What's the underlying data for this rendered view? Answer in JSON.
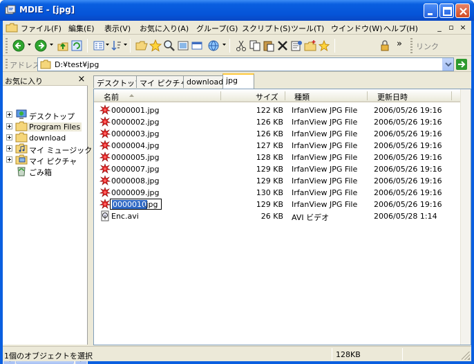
{
  "window": {
    "title": "MDIE - [jpg]",
    "buttons": [
      "minimize",
      "maximize",
      "close"
    ]
  },
  "menubar": {
    "items": [
      {
        "label": "ファイル(F)"
      },
      {
        "label": "編集(E)"
      },
      {
        "label": "表示(V)"
      },
      {
        "label": "お気に入り(A)"
      },
      {
        "label": "グループ(G)"
      },
      {
        "label": "スクリプト(S)"
      },
      {
        "label": "ツール(T)"
      },
      {
        "label": "ウインドウ(W)"
      },
      {
        "label": "ヘルプ(H)"
      }
    ],
    "mdi_controls": [
      "_",
      "▫",
      "×"
    ]
  },
  "toolbar": {
    "chevron": "»",
    "link_label": "リンク"
  },
  "address": {
    "label": "アドレス",
    "value": "D:¥test¥jpg"
  },
  "favorites": {
    "title": "お気に入り",
    "close": "×",
    "items": [
      {
        "label": "デスクトップ",
        "icon": "desktop-icon"
      },
      {
        "label": "Program Files",
        "icon": "folder-icon",
        "selected": true
      },
      {
        "label": "download",
        "icon": "folder-icon"
      },
      {
        "label": "マイ ミュージック",
        "icon": "music-folder-icon"
      },
      {
        "label": "マイ ピクチャ",
        "icon": "picture-folder-icon"
      },
      {
        "label": "ごみ箱",
        "icon": "recycle-bin-icon"
      }
    ]
  },
  "tabs": [
    {
      "label": "デスクトップ"
    },
    {
      "label": "マイ ピクチャ"
    },
    {
      "label": "download"
    },
    {
      "label": "jpg",
      "active": true
    }
  ],
  "list": {
    "columns": {
      "name": "名前",
      "size": "サイズ",
      "type": "種類",
      "date": "更新日時"
    },
    "rows": [
      {
        "name": "0000001.jpg",
        "size": "122 KB",
        "type": "IrfanView JPG File",
        "date": "2006/05/26 19:16"
      },
      {
        "name": "0000002.jpg",
        "size": "126 KB",
        "type": "IrfanView JPG File",
        "date": "2006/05/26 19:16"
      },
      {
        "name": "0000003.jpg",
        "size": "126 KB",
        "type": "IrfanView JPG File",
        "date": "2006/05/26 19:16"
      },
      {
        "name": "0000004.jpg",
        "size": "127 KB",
        "type": "IrfanView JPG File",
        "date": "2006/05/26 19:16"
      },
      {
        "name": "0000005.jpg",
        "size": "128 KB",
        "type": "IrfanView JPG File",
        "date": "2006/05/26 19:16"
      },
      {
        "name": "0000007.jpg",
        "size": "129 KB",
        "type": "IrfanView JPG File",
        "date": "2006/05/26 19:16"
      },
      {
        "name": "0000008.jpg",
        "size": "129 KB",
        "type": "IrfanView JPG File",
        "date": "2006/05/26 19:16"
      },
      {
        "name": "0000009.jpg",
        "size": "130 KB",
        "type": "IrfanView JPG File",
        "date": "2006/05/26 19:16"
      },
      {
        "name": "0000010.jpg",
        "size": "129 KB",
        "type": "IrfanView JPG File",
        "date": "2006/05/26 19:16",
        "rename_selected": "0000010",
        "rename_rest": ".jpg"
      },
      {
        "name": "Enc.avi",
        "size": "26 KB",
        "type": "AVI ビデオ",
        "date": "2006/05/28 1:14"
      }
    ]
  },
  "status": {
    "text": "1個のオブジェクトを選択",
    "size": "128KB"
  },
  "colors": {
    "title_blue": "#0a5fe0",
    "selection": "#316ac5",
    "tab_highlight": "#ffc83c"
  }
}
